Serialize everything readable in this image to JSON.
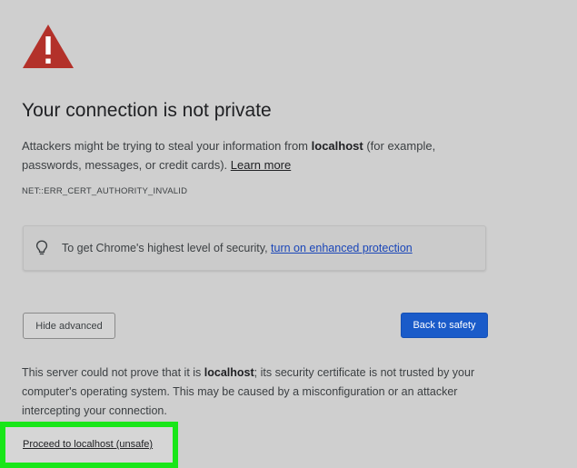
{
  "warning": {
    "icon": "warning-triangle-icon",
    "color": "#b3312a"
  },
  "title": "Your connection is not private",
  "description": {
    "part1": "Attackers might be trying to steal your information from ",
    "host": "localhost",
    "part2": " (for example, passwords, messages, or credit cards). ",
    "learn_more": "Learn more"
  },
  "error_code": "NET::ERR_CERT_AUTHORITY_INVALID",
  "enhanced_protection": {
    "icon": "lightbulb-icon",
    "text": "To get Chrome's highest level of security, ",
    "link": "turn on enhanced protection"
  },
  "buttons": {
    "hide_advanced": "Hide advanced",
    "back_to_safety": "Back to safety",
    "back_to_safety_color": "#1a5bc9"
  },
  "details": {
    "part1": "This server could not prove that it is ",
    "host": "localhost",
    "part2": "; its security certificate is not trusted by your computer's operating system. This may be caused by a misconfiguration or an attacker intercepting your connection."
  },
  "proceed_link": "Proceed to localhost (unsafe)",
  "highlight_color": "#19e619"
}
